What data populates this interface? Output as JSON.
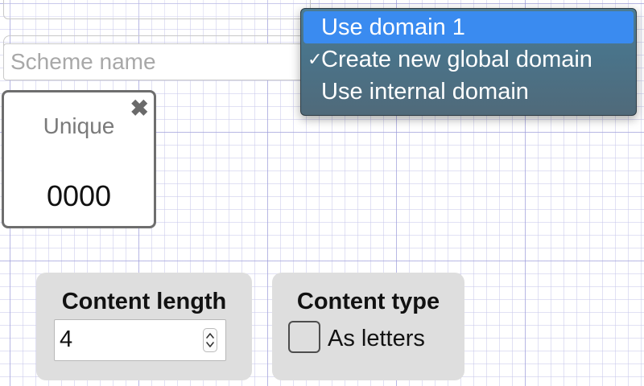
{
  "scheme_name": {
    "value": "",
    "placeholder": "Scheme name"
  },
  "domain_menu": {
    "options": [
      {
        "label": "Use domain 1",
        "highlighted": true,
        "checked": false
      },
      {
        "label": "Create new global domain",
        "highlighted": false,
        "checked": true
      },
      {
        "label": "Use internal domain",
        "highlighted": false,
        "checked": false
      }
    ],
    "check_glyph": "✓"
  },
  "unique_card": {
    "title": "Unique",
    "value": "0000",
    "close_glyph": "✖",
    "close_icon": "close-icon"
  },
  "content_length": {
    "label": "Content length",
    "value": "4",
    "stepper_icon": "stepper-arrows-icon"
  },
  "content_type": {
    "label": "Content type",
    "checkbox_label": "As letters",
    "checked": false
  },
  "colors": {
    "menu_highlight": "#3a8bf0",
    "menu_background": "#4a7389",
    "option_box_background": "#dedede",
    "grid_line": "#c8c8eb"
  }
}
